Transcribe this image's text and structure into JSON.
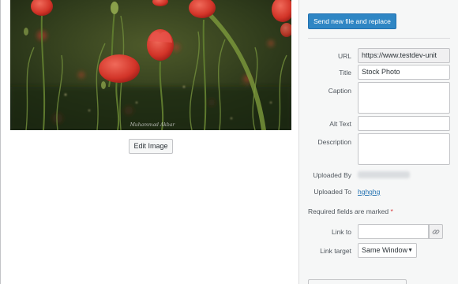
{
  "preview": {
    "watermark": "Muhammad Akbar",
    "edit_image_label": "Edit Image"
  },
  "sidebar": {
    "replace_button_label": "Send new file and replace",
    "fields": {
      "url": {
        "label": "URL",
        "value": "https://www.testdev-unit"
      },
      "title": {
        "label": "Title",
        "value": "Stock Photo"
      },
      "caption": {
        "label": "Caption",
        "value": ""
      },
      "alt_text": {
        "label": "Alt Text",
        "value": ""
      },
      "description": {
        "label": "Description",
        "value": ""
      }
    },
    "uploaded_by": {
      "label": "Uploaded By"
    },
    "uploaded_to": {
      "label": "Uploaded To",
      "value": "hghghg"
    },
    "required_note": "Required fields are marked",
    "required_star": "*",
    "link_to": {
      "label": "Link to",
      "value": ""
    },
    "link_target": {
      "label": "Link target",
      "selected": "Same Window"
    }
  },
  "icons": {
    "link_button": "link-icon",
    "select_caret": "caret-down-icon"
  },
  "colors": {
    "primary_button": "#2f86c4",
    "link": "#2271b1",
    "required": "#d63638"
  }
}
